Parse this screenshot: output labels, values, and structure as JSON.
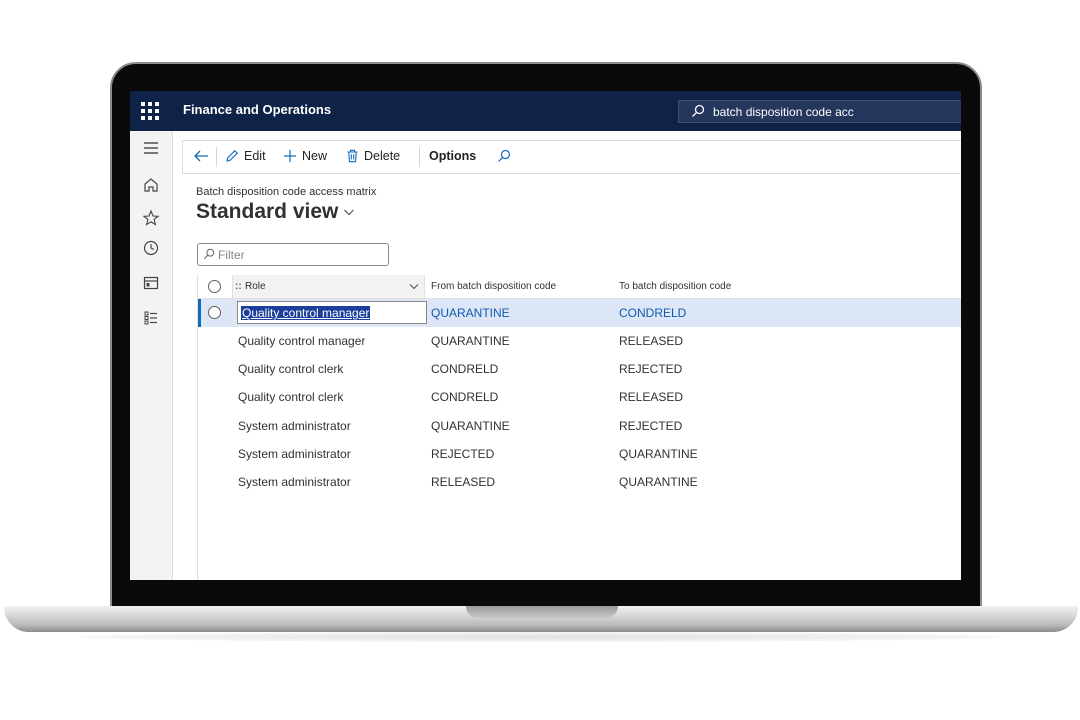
{
  "app": {
    "title": "Finance and Operations",
    "search_value": "batch disposition code acc"
  },
  "toolbar": {
    "edit": "Edit",
    "new": "New",
    "delete": "Delete",
    "options": "Options"
  },
  "page": {
    "caption": "Batch disposition code access matrix",
    "view_name": "Standard view",
    "filter_placeholder": "Filter"
  },
  "grid": {
    "columns": [
      "Role",
      "From batch disposition code",
      "To batch disposition code"
    ],
    "rows": [
      {
        "role": "Quality control manager",
        "from": "QUARANTINE",
        "to": "CONDRELD"
      },
      {
        "role": "Quality control manager",
        "from": "QUARANTINE",
        "to": "RELEASED"
      },
      {
        "role": "Quality control clerk",
        "from": "CONDRELD",
        "to": "REJECTED"
      },
      {
        "role": "Quality control clerk",
        "from": "CONDRELD",
        "to": "RELEASED"
      },
      {
        "role": "System administrator",
        "from": "QUARANTINE",
        "to": "REJECTED"
      },
      {
        "role": "System administrator",
        "from": "REJECTED",
        "to": "QUARANTINE"
      },
      {
        "role": "System administrator",
        "from": "RELEASED",
        "to": "QUARANTINE"
      }
    ]
  },
  "colors": {
    "navbar": "#0f2248",
    "accent": "#0f6cbd",
    "selected_row": "#dce6f6"
  },
  "icons": [
    "waffle-icon",
    "search-icon",
    "hamburger-icon",
    "home-icon",
    "star-icon",
    "clock-icon",
    "workspace-icon",
    "list-icon",
    "back-arrow-icon",
    "pencil-icon",
    "plus-icon",
    "trash-icon",
    "chevron-down-icon"
  ]
}
